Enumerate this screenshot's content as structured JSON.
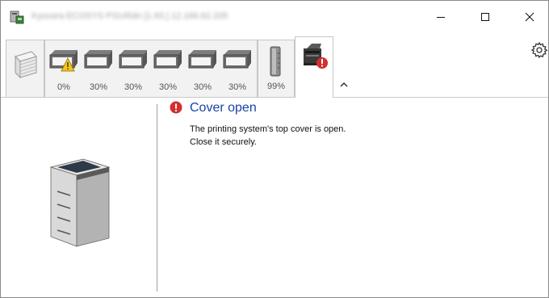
{
  "window": {
    "title": "Kyocera ECOSYS P3145dn [1.93.] 12.166.62.205",
    "controls": {
      "minimize_icon": "minimize-icon",
      "maximize_icon": "maximize-icon",
      "close_icon": "close-icon"
    }
  },
  "toolbar": {
    "paper_tab_icon": "paper-stack-icon",
    "trays": [
      {
        "level": "0%",
        "warning": true
      },
      {
        "level": "30%",
        "warning": false
      },
      {
        "level": "30%",
        "warning": false
      },
      {
        "level": "30%",
        "warning": false
      },
      {
        "level": "30%",
        "warning": false
      },
      {
        "level": "30%",
        "warning": false
      }
    ],
    "toner": {
      "level": "99%"
    },
    "device_tab_icon": "device-error-icon",
    "collapse_icon": "chevron-up-icon",
    "settings_icon": "gear-icon"
  },
  "status": {
    "title": "Cover open",
    "line1": "The printing system's top cover is open.",
    "line2": "Close it securely.",
    "error_color": "#d32f2f",
    "title_color": "#1a43a8"
  }
}
